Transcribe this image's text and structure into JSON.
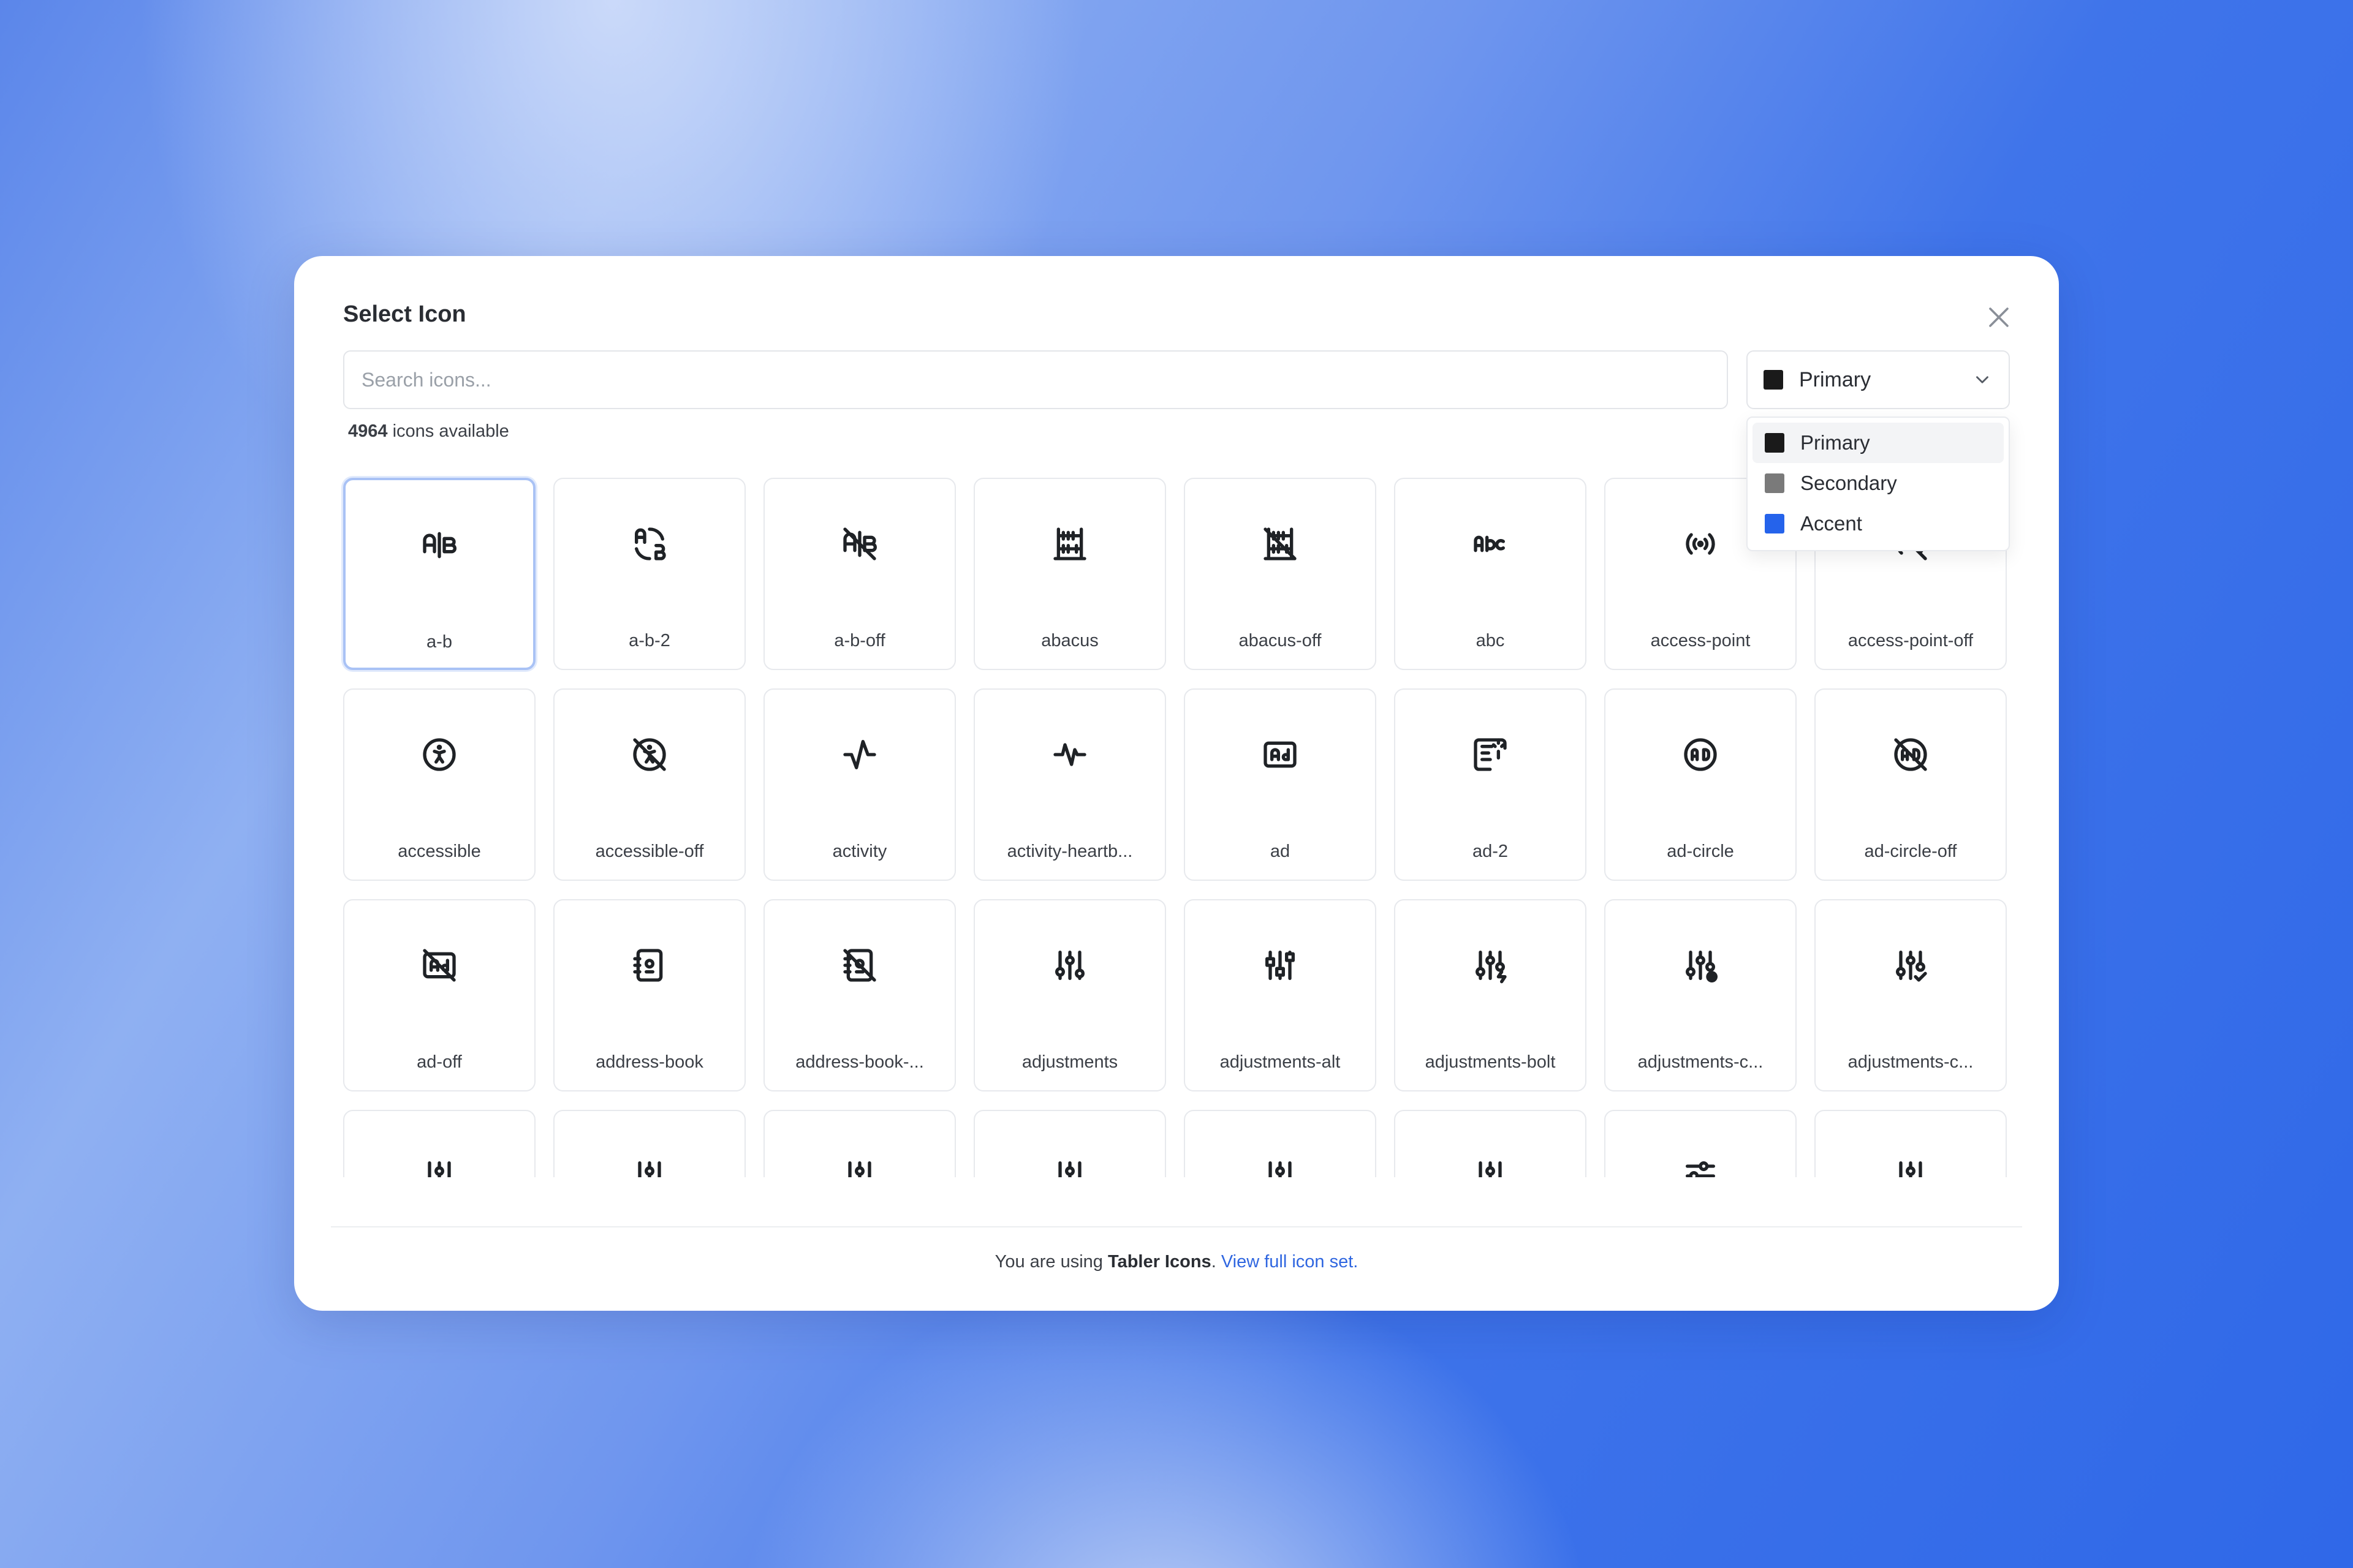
{
  "dialog": {
    "title": "Select Icon",
    "close_icon": "close-icon"
  },
  "search": {
    "placeholder": "Search icons...",
    "value": ""
  },
  "color_select": {
    "selected": {
      "label": "Primary",
      "color": "#1a1a1a"
    },
    "options": [
      {
        "label": "Primary",
        "color": "#1a1a1a"
      },
      {
        "label": "Secondary",
        "color": "#7a7a7a"
      },
      {
        "label": "Accent",
        "color": "#2563eb"
      }
    ]
  },
  "count": {
    "number": "4964",
    "suffix": " icons available"
  },
  "icons": [
    {
      "name": "a-b",
      "icon": "a-b-icon"
    },
    {
      "name": "a-b-2",
      "icon": "a-b-2-icon"
    },
    {
      "name": "a-b-off",
      "icon": "a-b-off-icon"
    },
    {
      "name": "abacus",
      "icon": "abacus-icon"
    },
    {
      "name": "abacus-off",
      "icon": "abacus-off-icon"
    },
    {
      "name": "abc",
      "icon": "abc-icon"
    },
    {
      "name": "access-point",
      "icon": "access-point-icon"
    },
    {
      "name": "access-point-off",
      "icon": "access-point-off-icon"
    },
    {
      "name": "accessible",
      "icon": "accessible-icon"
    },
    {
      "name": "accessible-off",
      "icon": "accessible-off-icon"
    },
    {
      "name": "activity",
      "icon": "activity-icon"
    },
    {
      "name": "activity-heartb...",
      "icon": "activity-heartbeat-icon"
    },
    {
      "name": "ad",
      "icon": "ad-icon"
    },
    {
      "name": "ad-2",
      "icon": "ad-2-icon"
    },
    {
      "name": "ad-circle",
      "icon": "ad-circle-icon"
    },
    {
      "name": "ad-circle-off",
      "icon": "ad-circle-off-icon"
    },
    {
      "name": "ad-off",
      "icon": "ad-off-icon"
    },
    {
      "name": "address-book",
      "icon": "address-book-icon"
    },
    {
      "name": "address-book-...",
      "icon": "address-book-off-icon"
    },
    {
      "name": "adjustments",
      "icon": "adjustments-icon"
    },
    {
      "name": "adjustments-alt",
      "icon": "adjustments-alt-icon"
    },
    {
      "name": "adjustments-bolt",
      "icon": "adjustments-bolt-icon"
    },
    {
      "name": "adjustments-c...",
      "icon": "adjustments-cancel-icon"
    },
    {
      "name": "adjustments-c...",
      "icon": "adjustments-check-icon"
    },
    {
      "name": "",
      "icon": "adjustments-icon"
    },
    {
      "name": "",
      "icon": "adjustments-icon"
    },
    {
      "name": "",
      "icon": "adjustments-icon"
    },
    {
      "name": "",
      "icon": "adjustments-icon"
    },
    {
      "name": "",
      "icon": "adjustments-icon"
    },
    {
      "name": "",
      "icon": "adjustments-icon"
    },
    {
      "name": "",
      "icon": "adjustments-horizontal-icon"
    },
    {
      "name": "",
      "icon": "adjustments-icon"
    }
  ],
  "footer": {
    "prefix": "You are using ",
    "brand": "Tabler Icons",
    "middle": ". ",
    "link": "View full icon set."
  }
}
